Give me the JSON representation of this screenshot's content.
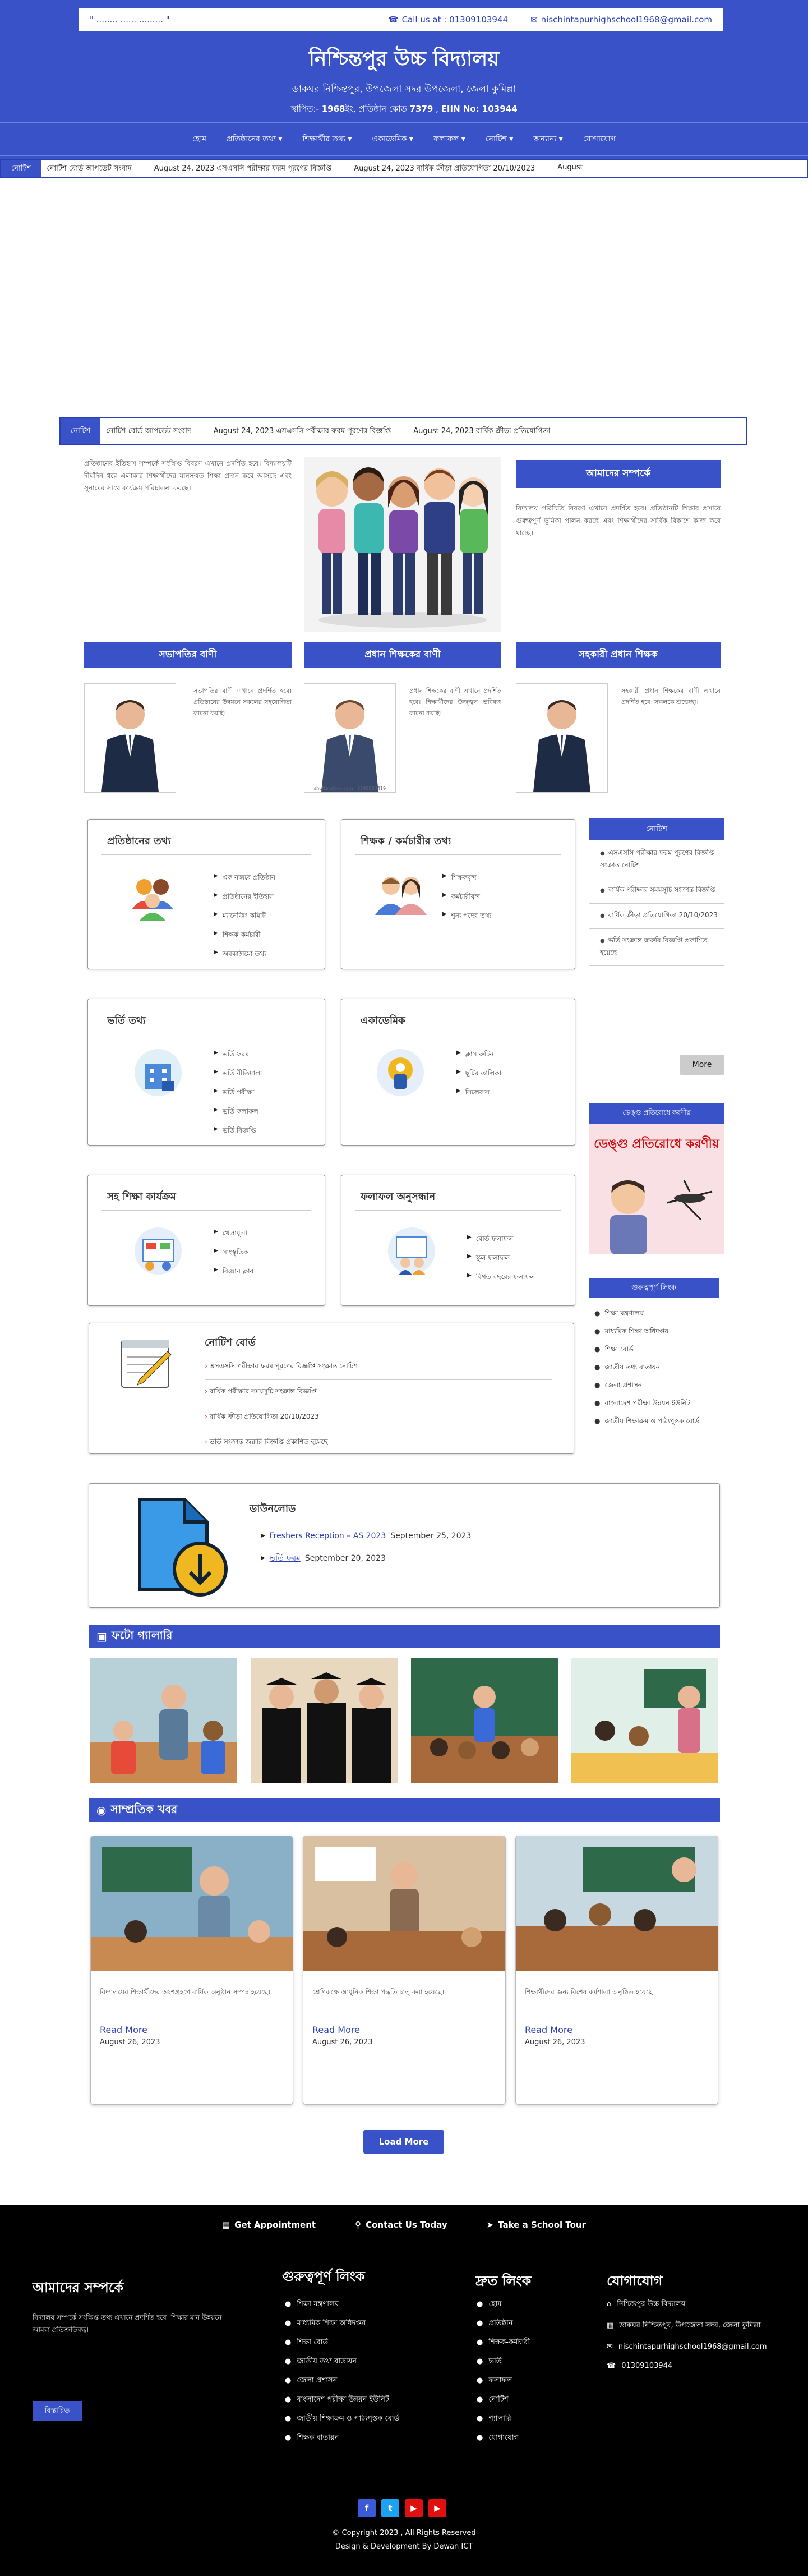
{
  "topbar": {
    "motto": "\" ........ ...... ......... \"",
    "phone_label": "Call us at : 01309103944",
    "email": "nischintapurhighschool1968@gmail.com"
  },
  "site": {
    "title": "নিশ্চিন্তপুর উচ্চ বিদ্যালয়",
    "address": "ডাকঘর নিশ্চিন্তপুর, উপজেলা সদর উপজেলা, জেলা কুমিল্লা",
    "meta_prefix": "স্থাপিত:-",
    "established": "1968",
    "meta_mid": "ইং, প্রতিষ্ঠান কোড",
    "code": "7379",
    "eiin": "EIIN No: 103944"
  },
  "nav": [
    "হোম",
    "প্রতিষ্ঠানের তথ্য ▾",
    "শিক্ষার্থীর তথ্য ▾",
    "একাডেমিক ▾",
    "ফলাফল ▾",
    "নোটিশ ▾",
    "অন্যান্য ▾",
    "যোগাযোগ"
  ],
  "ticker1": {
    "label": "নোটিশ",
    "items": [
      "নোটিশ বোর্ড আপডেট সংবাদ",
      "August 24, 2023 এসএসসি পরীক্ষার ফরম পূরণের বিজ্ঞপ্তি",
      "August 24, 2023 বার্ষিক ক্রীড়া প্রতিযোগিতা 20/10/2023",
      "August"
    ]
  },
  "ticker2": {
    "label": "নোটিশ",
    "items": [
      "নোটিশ বোর্ড আপডেট সংবাদ",
      "August 24, 2023 এসএসসি পরীক্ষার ফরম পূরণের বিজ্ঞপ্তি",
      "August 24, 2023 বার্ষিক ক্রীড়া প্রতিযোগিতা"
    ]
  },
  "intro": {
    "text": "প্রতিষ্ঠানের ইতিহাস সম্পর্কে সংক্ষিপ্ত বিবরণ এখানে প্রদর্শিত হবে। বিদ্যালয়টি দীর্ঘদিন ধরে এলাকার শিক্ষার্থীদের মানসম্মত শিক্ষা প্রদান করে আসছে এবং সুনামের সাথে কার্যক্রম পরিচালনা করছে।",
    "right_title": "আমাদের সম্পর্কে",
    "right_text": "বিদ্যালয় পরিচিতি বিবরণ এখানে প্রদর্শিত হবে। প্রতিষ্ঠানটি শিক্ষার প্রসারে গুরুত্বপূর্ণ ভূমিকা পালন করছে এবং শিক্ষার্থীদের সার্বিক বিকাশে কাজ করে যাচ্ছে।"
  },
  "people": [
    {
      "title": "সভাপতির বাণী",
      "text": "সভাপতির বাণী এখানে প্রদর্শিত হবে। প্রতিষ্ঠানের উন্নয়নে সকলের সহযোগিতা কামনা করছি।"
    },
    {
      "title": "প্রধান শিক্ষকের বাণী",
      "text": "প্রধান শিক্ষকের বাণী এখানে প্রদর্শিত হবে। শিক্ষার্থীদের উজ্জ্বল ভবিষ্যৎ কামনা করছি।",
      "caption": "shutterstock.com · 2248883419"
    },
    {
      "title": "সহকারী প্রধান শিক্ষক",
      "text": "সহকারী প্রধান শিক্ষকের বাণী এখানে প্রদর্শিত হবে। সকলকে শুভেচ্ছা।"
    }
  ],
  "cards": [
    {
      "title": "প্রতিষ্ঠানের তথ্য",
      "items": [
        "এক নজরে প্রতিষ্ঠান",
        "প্রতিষ্ঠানের ইতিহাস",
        "ম্যানেজিং কমিটি",
        "শিক্ষক-কর্মচারী",
        "অবকাঠামো তথ্য"
      ]
    },
    {
      "title": "শিক্ষক / কর্মচারীর তথ্য",
      "items": [
        "শিক্ষকবৃন্দ",
        "কর্মচারীবৃন্দ",
        "শূন্য পদের তথ্য"
      ]
    },
    {
      "title": "ভর্তি তথ্য",
      "items": [
        "ভর্তি ফরম",
        "ভর্তি নীতিমালা",
        "ভর্তি পরীক্ষা",
        "ভর্তি ফলাফল",
        "ভর্তি বিজ্ঞপ্তি"
      ]
    },
    {
      "title": "একাডেমিক",
      "items": [
        "ক্লাস রুটিন",
        "ছুটির তালিকা",
        "সিলেবাস"
      ]
    },
    {
      "title": "সহ শিক্ষা কার্যক্রম",
      "items": [
        "খেলাধুলা",
        "সাংস্কৃতিক",
        "বিজ্ঞান ক্লাব"
      ]
    },
    {
      "title": "ফলাফল অনুসন্ধান",
      "items": [
        "বোর্ড ফলাফল",
        "স্কুল ফলাফল",
        "বিগত বছরের ফলাফল"
      ]
    }
  ],
  "notices": {
    "title": "নোটিশ",
    "items": [
      "এসএসসি পরীক্ষার ফরম পূরণের বিজ্ঞপ্তি সংক্রান্ত নোটিশ",
      "বার্ষিক পরীক্ষার সময়সূচি সংক্রান্ত বিজ্ঞপ্তি",
      "বার্ষিক ক্রীড়া প্রতিযোগিতা 20/10/2023",
      "ভর্তি সংক্রান্ত জরুরি বিজ্ঞপ্তি প্রকাশিত হয়েছে"
    ],
    "more": "More"
  },
  "dengue": {
    "title": "ডেঙ্গু প্রতিরোধে করণীয়",
    "banner": "ডেঙ্গু প্রতিরোধে করণীয়"
  },
  "links": {
    "title": "গুরুত্বপূর্ণ লিংক",
    "items": [
      "শিক্ষা মন্ত্রণালয়",
      "মাধ্যমিক শিক্ষা অধিদপ্তর",
      "শিক্ষা বোর্ড",
      "জাতীয় তথ্য বাতায়ন",
      "জেলা প্রশাসন",
      "বাংলাদেশ পরীক্ষা উন্নয়ন ইউনিট",
      "জাতীয় শিক্ষাক্রম ও পাঠ্যপুস্তক বোর্ড"
    ]
  },
  "notice_board": {
    "title": "নোটিশ বোর্ড",
    "items": [
      "এসএসসি পরীক্ষার ফরম পূরণের বিজ্ঞপ্তি সংক্রান্ত নোটিশ",
      "বার্ষিক পরীক্ষার সময়সূচি সংক্রান্ত বিজ্ঞপ্তি",
      "বার্ষিক ক্রীড়া প্রতিযোগিতা 20/10/2023",
      "ভর্তি সংক্রান্ত জরুরি বিজ্ঞপ্তি প্রকাশিত হয়েছে"
    ]
  },
  "downloads": {
    "title": "ডাউনলোড",
    "items": [
      {
        "link": "Freshers Reception – AS 2023",
        "date": "September 25, 2023"
      },
      {
        "link": "ভর্তি ফরম",
        "date": "September 20, 2023"
      }
    ]
  },
  "gallery": {
    "title": "ফটো গ্যালারি"
  },
  "news": {
    "title": "সাম্প্রতিক খবর",
    "cards": [
      {
        "text": "বিদ্যালয়ের শিক্ষার্থীদের অংশগ্রহণে বার্ষিক অনুষ্ঠান সম্পন্ন হয়েছে।",
        "more": "Read More",
        "date": "August 26, 2023"
      },
      {
        "text": "শ্রেণিকক্ষে আধুনিক শিক্ষা পদ্ধতি চালু করা হয়েছে।",
        "more": "Read More",
        "date": "August 26, 2023"
      },
      {
        "text": "শিক্ষার্থীদের জন্য বিশেষ কর্মশালা অনুষ্ঠিত হয়েছে।",
        "more": "Read More",
        "date": "August 26, 2023"
      }
    ],
    "load_more": "Load More"
  },
  "cta": {
    "appointment": "Get Appointment",
    "contact": "Contact Us Today",
    "tour": "Take a School Tour"
  },
  "footer": {
    "about_title": "আমাদের সম্পর্কে",
    "about_text": "বিদ্যালয় সম্পর্কে সংক্ষিপ্ত তথ্য এখানে প্রদর্শিত হবে। শিক্ষার মান উন্নয়নে আমরা প্রতিশ্রুতিবদ্ধ।",
    "about_btn": "বিস্তারিত",
    "links1_title": "গুরুত্বপূর্ণ লিংক",
    "links1": [
      "শিক্ষা মন্ত্রণালয়",
      "মাধ্যমিক শিক্ষা অধিদপ্তর",
      "শিক্ষা বোর্ড",
      "জাতীয় তথ্য বাতায়ন",
      "জেলা প্রশাসন",
      "বাংলাদেশ পরীক্ষা উন্নয়ন ইউনিট",
      "জাতীয় শিক্ষাক্রম ও পাঠ্যপুস্তক বোর্ড",
      "শিক্ষক বাতায়ন"
    ],
    "links2_title": "দ্রুত লিংক",
    "links2": [
      "হোম",
      "প্রতিষ্ঠান",
      "শিক্ষক-কর্মচারী",
      "ভর্তি",
      "ফলাফল",
      "নোটিশ",
      "গ্যালারি",
      "যোগাযোগ"
    ],
    "contact_title": "যোগাযোগ",
    "contact": [
      "নিশ্চিন্তপুর উচ্চ বিদ্যালয়",
      "ডাকঘর নিশ্চিন্তপুর, উপজেলা সদর, জেলা কুমিল্লা",
      "nischintapurhighschool1968@gmail.com",
      "01309103944"
    ],
    "copyright": "© Copyright 2023 , All Rights Reserved",
    "credit": "Design & Development By Dewan ICT"
  }
}
